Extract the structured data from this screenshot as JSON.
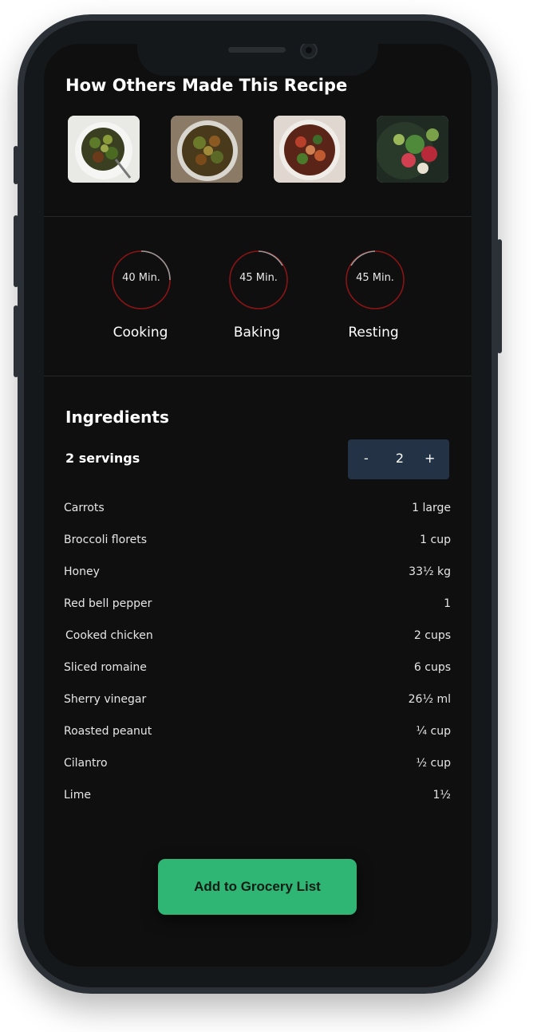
{
  "gallery": {
    "title": "How Others Made This Recipe",
    "photos": [
      "recipe-photo-1",
      "recipe-photo-2",
      "recipe-photo-3",
      "recipe-photo-4"
    ]
  },
  "timers": [
    {
      "value": "40 Min.",
      "label": "Cooking",
      "progress": 0.25
    },
    {
      "value": "45 Min.",
      "label": "Baking",
      "progress": 0.2
    },
    {
      "value": "45 Min.",
      "label": "Resting",
      "progress": 0.2
    }
  ],
  "ingredients": {
    "title": "Ingredients",
    "servings_label": "2 servings",
    "stepper": {
      "minus": "-",
      "value": "2",
      "plus": "+"
    },
    "items": [
      {
        "name": "Carrots",
        "qty": "1 large"
      },
      {
        "name": "Broccoli florets",
        "qty": "1 cup"
      },
      {
        "name": "Honey",
        "qty": "33½ kg"
      },
      {
        "name": "Red bell pepper",
        "qty": "1"
      },
      {
        "name": "Cooked chicken",
        "qty": "2 cups"
      },
      {
        "name": "Sliced romaine",
        "qty": "6 cups"
      },
      {
        "name": "Sherry vinegar",
        "qty": "26½ ml"
      },
      {
        "name": "Roasted peanut",
        "qty": "¼ cup"
      },
      {
        "name": "Cilantro",
        "qty": "½ cup"
      },
      {
        "name": "Lime",
        "qty": "1½"
      }
    ]
  },
  "cta": {
    "label": "Add to Grocery List"
  },
  "colors": {
    "background": "#0f0f10",
    "accent": "#2fb574",
    "stepper_bg": "#233345",
    "ring_progress": "#8a1414",
    "ring_track": "#9a9a9a"
  }
}
